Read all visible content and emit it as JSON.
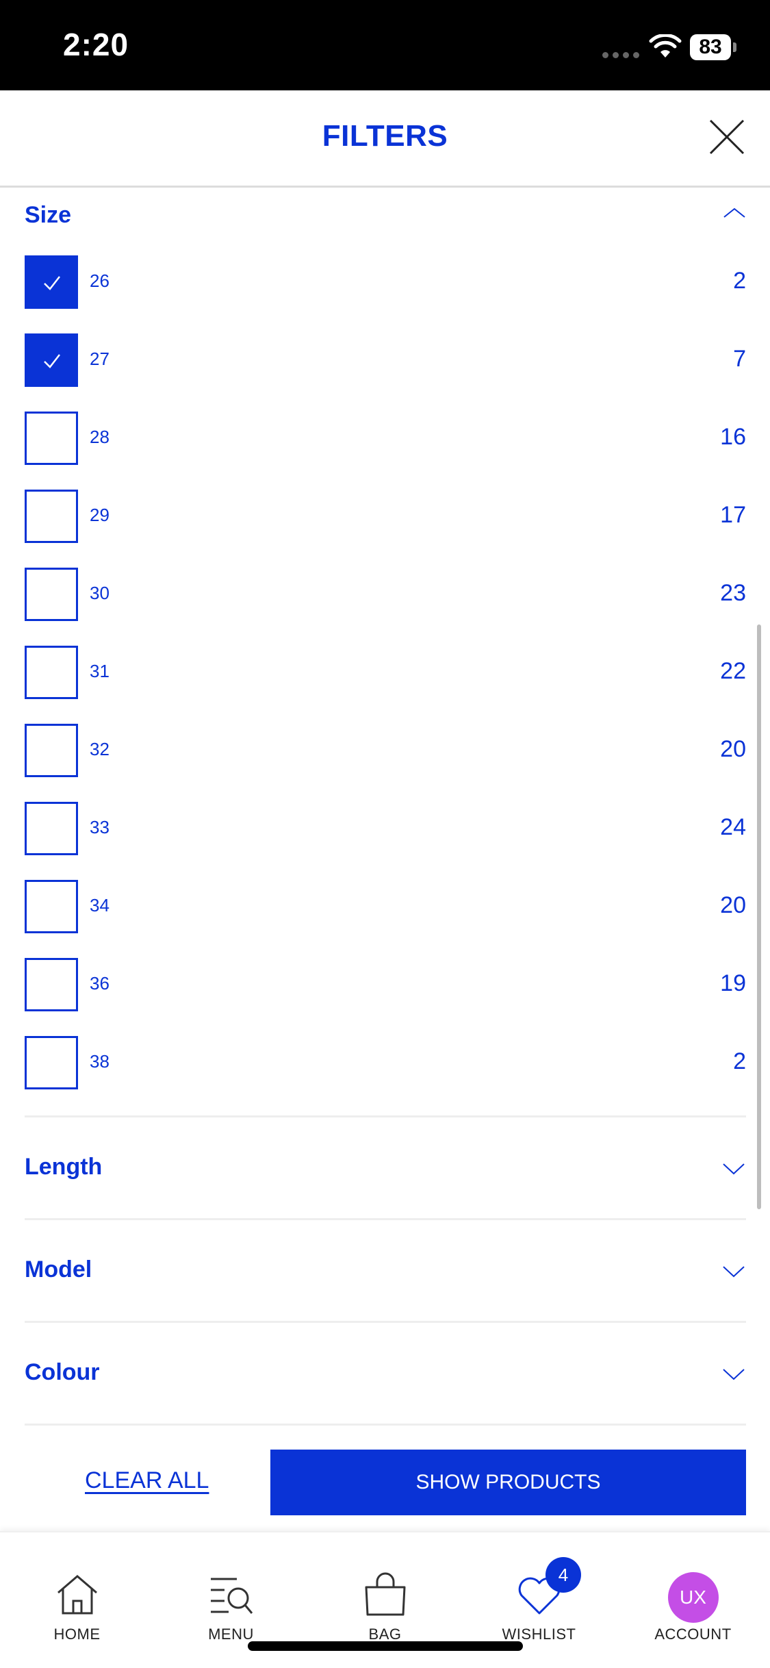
{
  "status_bar": {
    "time": "2:20",
    "battery": "83"
  },
  "header": {
    "title": "FILTERS"
  },
  "size_section": {
    "title": "Size",
    "options": [
      {
        "label": "26",
        "count": "2",
        "checked": true
      },
      {
        "label": "27",
        "count": "7",
        "checked": true
      },
      {
        "label": "28",
        "count": "16",
        "checked": false
      },
      {
        "label": "29",
        "count": "17",
        "checked": false
      },
      {
        "label": "30",
        "count": "23",
        "checked": false
      },
      {
        "label": "31",
        "count": "22",
        "checked": false
      },
      {
        "label": "32",
        "count": "20",
        "checked": false
      },
      {
        "label": "33",
        "count": "24",
        "checked": false
      },
      {
        "label": "34",
        "count": "20",
        "checked": false
      },
      {
        "label": "36",
        "count": "19",
        "checked": false
      },
      {
        "label": "38",
        "count": "2",
        "checked": false
      }
    ]
  },
  "sections": [
    {
      "label": "Length"
    },
    {
      "label": "Model"
    },
    {
      "label": "Colour"
    }
  ],
  "actions": {
    "clear_all": "CLEAR ALL",
    "show_products": "SHOW PRODUCTS"
  },
  "tabs": [
    {
      "label": "HOME",
      "icon": "home-icon"
    },
    {
      "label": "MENU",
      "icon": "menu-search-icon"
    },
    {
      "label": "BAG",
      "icon": "bag-icon"
    },
    {
      "label": "WISHLIST",
      "icon": "heart-icon",
      "badge": "4"
    },
    {
      "label": "ACCOUNT",
      "icon": "avatar",
      "avatar_text": "UX"
    }
  ],
  "colors": {
    "brand_blue": "#0a33d6",
    "avatar_purple": "#c44ee6"
  }
}
